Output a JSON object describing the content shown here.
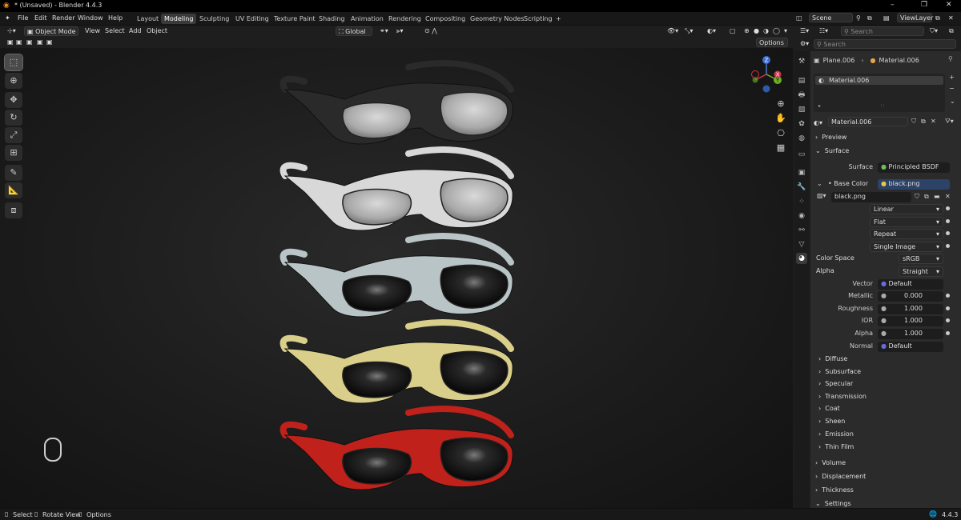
{
  "titlebar": {
    "title": "* (Unsaved) - Blender 4.4.3",
    "min": "–",
    "max": "❐",
    "close": "✕"
  },
  "menu": {
    "items": [
      "File",
      "Edit",
      "Render",
      "Window",
      "Help"
    ]
  },
  "workspaces": {
    "tabs": [
      "Layout",
      "Modeling",
      "Sculpting",
      "UV Editing",
      "Texture Paint",
      "Shading",
      "Animation",
      "Rendering",
      "Compositing",
      "Geometry Nodes",
      "Scripting"
    ],
    "active": "Modeling",
    "add": "+"
  },
  "scene": {
    "name": "Scene",
    "viewlayer": "ViewLayer"
  },
  "viewport_header": {
    "mode": "Object Mode",
    "menus": [
      "View",
      "Select",
      "Add",
      "Object"
    ],
    "transform": "Global",
    "options": "Options"
  },
  "outliner": {
    "search_placeholder": "Search"
  },
  "properties": {
    "search_placeholder": "Search",
    "breadcrumb": {
      "object": "Plane.006",
      "material": "Material.006"
    },
    "slot": "Material.006",
    "material_name": "Material.006",
    "sections": {
      "preview": "Preview",
      "surface": "Surface"
    },
    "surface_label": "Surface",
    "surface_value": "Principled BSDF",
    "base_color_label": "Base Color",
    "base_color_value": "black.png",
    "image_name": "black.png",
    "interpolation": "Linear",
    "projection": "Flat",
    "extension": "Repeat",
    "source": "Single Image",
    "color_space_label": "Color Space",
    "color_space": "sRGB",
    "alpha_label": "Alpha",
    "alpha_mode": "Straight",
    "fields": [
      {
        "label": "Vector",
        "value": "Default"
      },
      {
        "label": "Metallic",
        "value": "0.000"
      },
      {
        "label": "Roughness",
        "value": "1.000"
      },
      {
        "label": "IOR",
        "value": "1.000"
      },
      {
        "label": "Alpha",
        "value": "1.000"
      },
      {
        "label": "Normal",
        "value": "Default"
      }
    ],
    "subpanels": [
      "Diffuse",
      "Subsurface",
      "Specular",
      "Transmission",
      "Coat",
      "Sheen",
      "Emission",
      "Thin Film"
    ],
    "panels": [
      "Volume",
      "Displacement",
      "Thickness",
      "Settings"
    ]
  },
  "statusbar": {
    "select": "Select",
    "rotate": "Rotate View",
    "options": "Options",
    "version": "4.4.3"
  },
  "glasses": [
    {
      "frame": "#2a2a2a",
      "lens": "light"
    },
    {
      "frame": "#d8d8d8",
      "lens": "light"
    },
    {
      "frame": "#b9c4c6",
      "lens": "dark"
    },
    {
      "frame": "#d9cf8a",
      "lens": "dark"
    },
    {
      "frame": "#c0211b",
      "lens": "dark"
    }
  ],
  "colors": {
    "accent": "#4772b3",
    "slot_active": "#3d3d3d"
  }
}
